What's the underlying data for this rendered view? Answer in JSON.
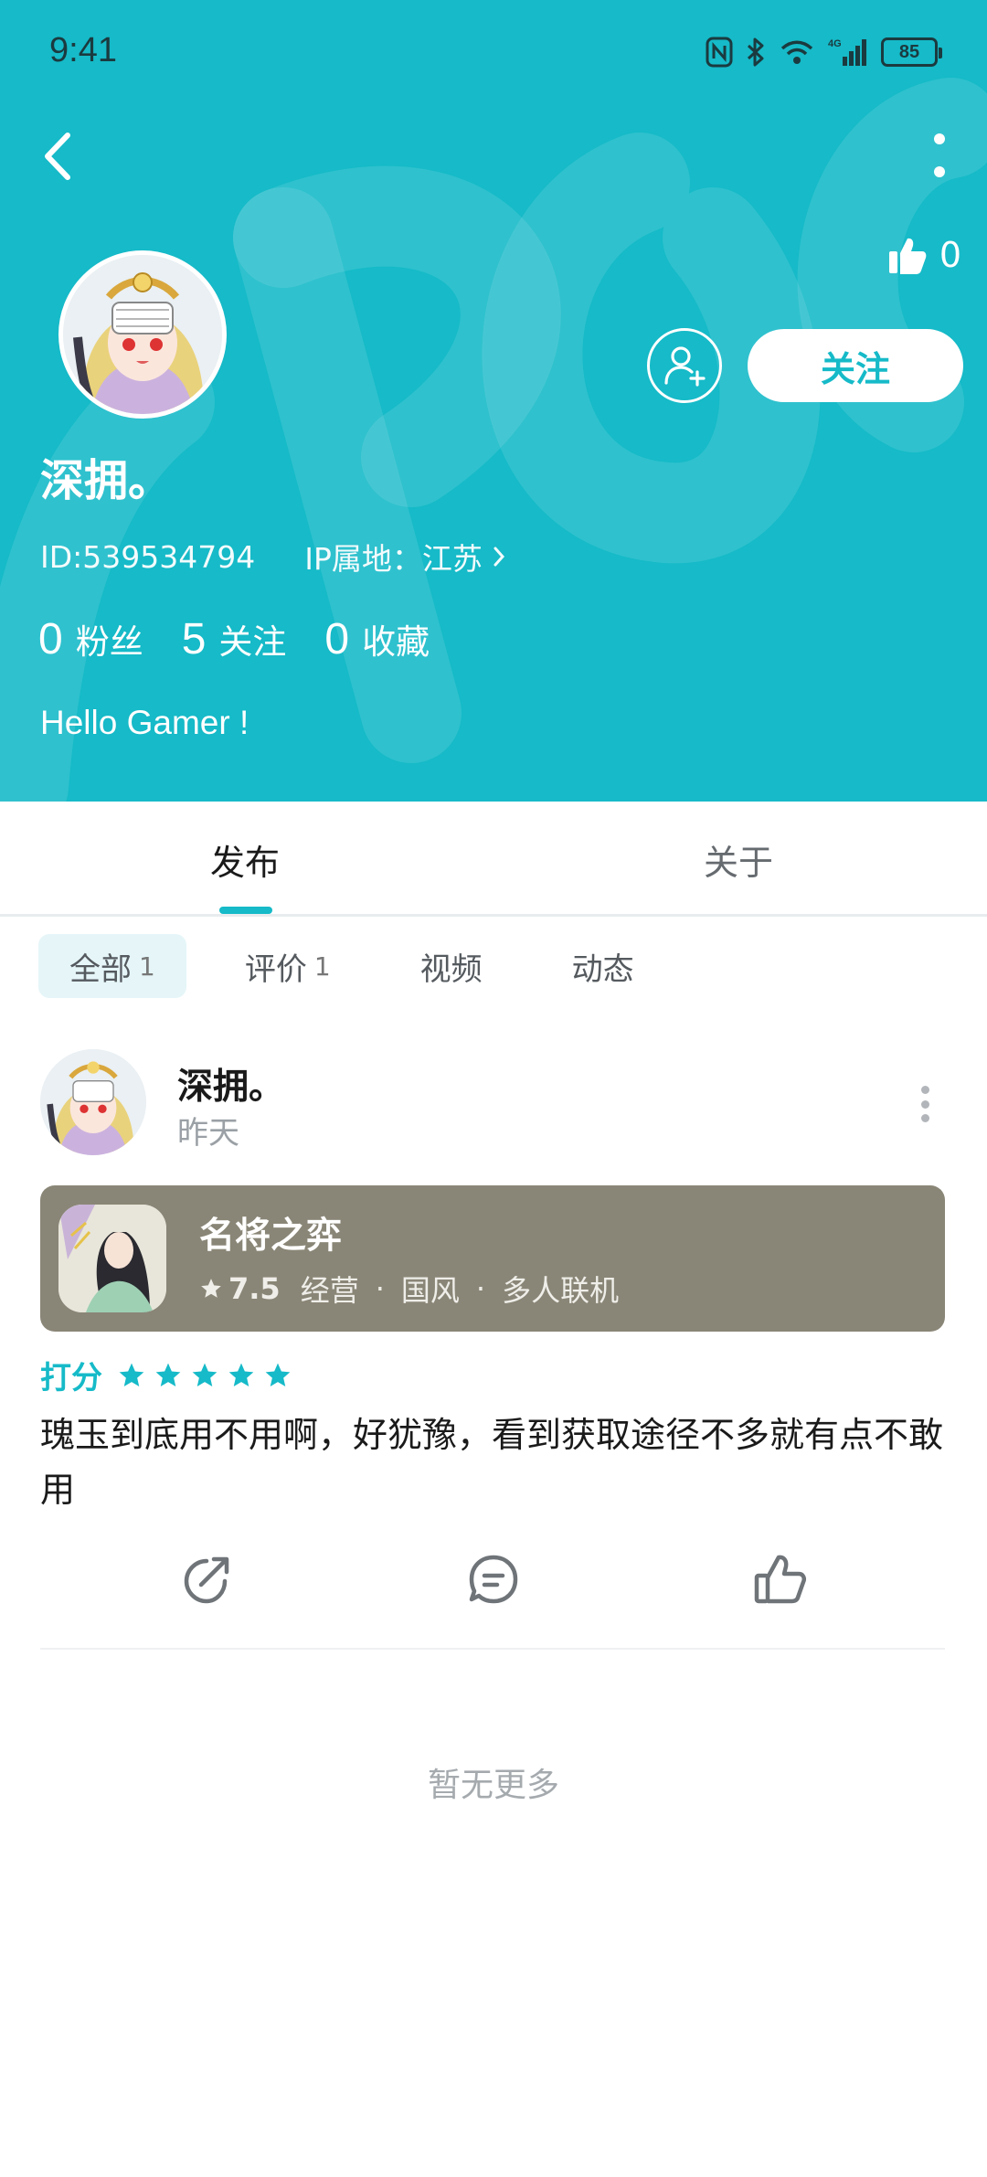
{
  "status_bar": {
    "time": "9:41",
    "battery": "85"
  },
  "header": {
    "likes_count": "0",
    "follow_label": "关注"
  },
  "profile": {
    "nickname": "深拥。",
    "id_text": "ID:539534794",
    "ip_text": "IP属地：江苏",
    "stats": [
      {
        "num": "0",
        "label": "粉丝"
      },
      {
        "num": "5",
        "label": "关注"
      },
      {
        "num": "0",
        "label": "收藏"
      }
    ],
    "bio": "Hello Gamer !"
  },
  "tabs": [
    {
      "label": "发布",
      "active": true
    },
    {
      "label": "关于",
      "active": false
    }
  ],
  "filters": [
    {
      "label": "全部",
      "count": "1",
      "active": true
    },
    {
      "label": "评价",
      "count": "1",
      "active": false
    },
    {
      "label": "视频",
      "count": "",
      "active": false
    },
    {
      "label": "动态",
      "count": "",
      "active": false
    }
  ],
  "post": {
    "author": "深拥。",
    "time": "昨天",
    "game": {
      "title": "名将之弈",
      "score": "7.5",
      "tags": [
        "经营",
        "国风",
        "多人联机"
      ]
    },
    "rating_label": "打分",
    "rating_stars": 5,
    "text": "瑰玉到底用不用啊，好犹豫，看到获取途径不多就有点不敢用"
  },
  "footer": {
    "no_more": "暂无更多"
  },
  "colors": {
    "accent": "#16bac8",
    "card_bg": "#8a8677"
  }
}
